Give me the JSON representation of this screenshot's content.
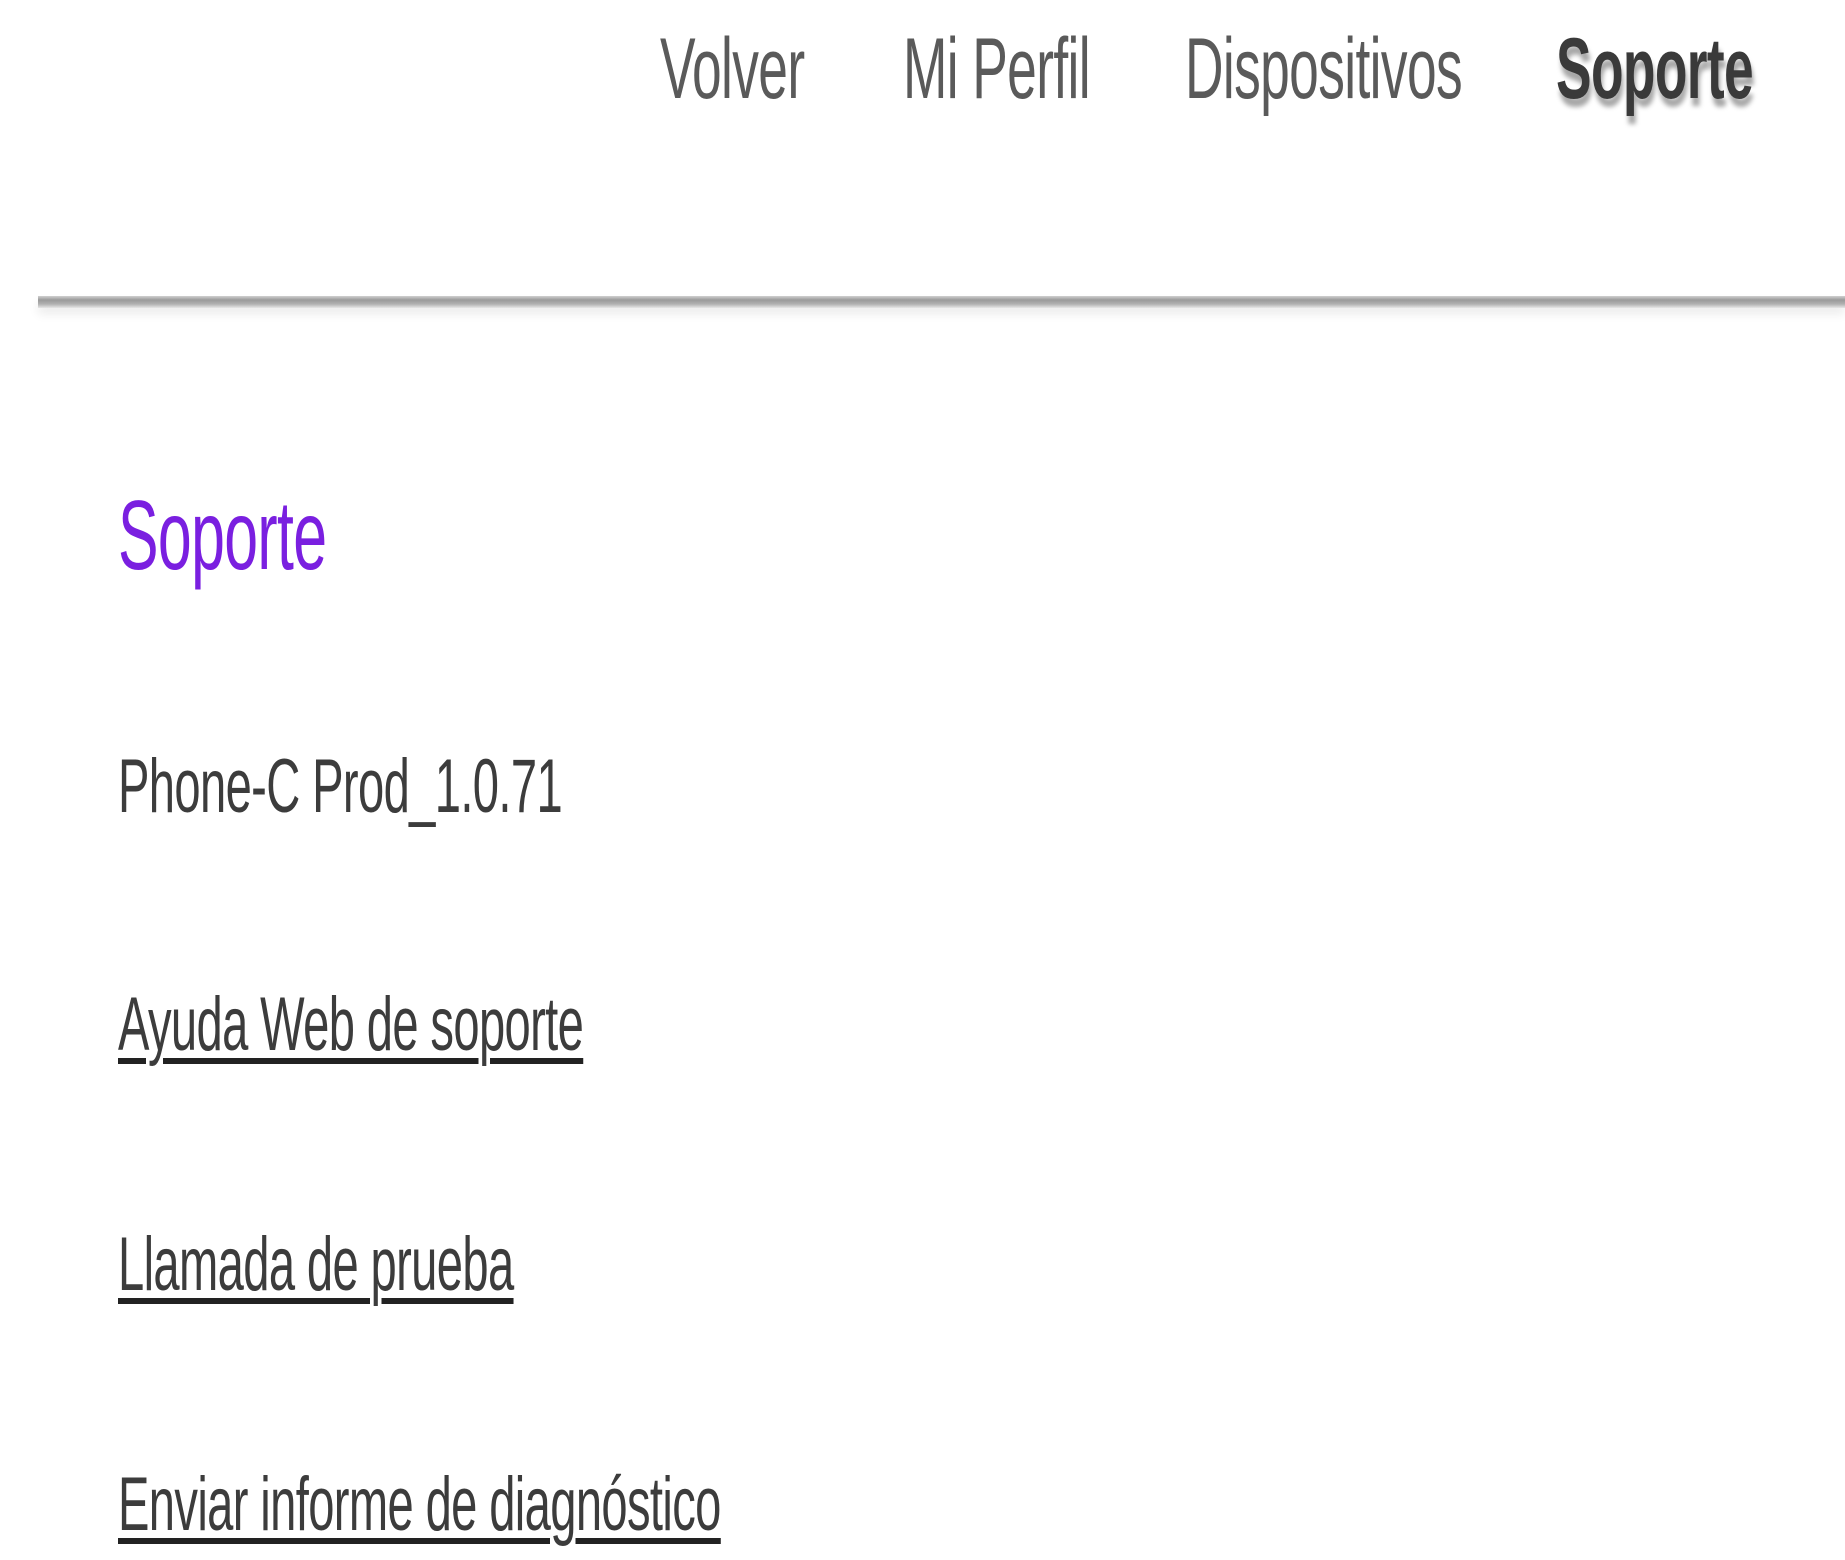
{
  "nav": {
    "items": [
      {
        "label": "Volver",
        "active": false
      },
      {
        "label": "Mi Perfil",
        "active": false
      },
      {
        "label": "Dispositivos",
        "active": false
      },
      {
        "label": "Soporte",
        "active": true
      }
    ]
  },
  "support": {
    "title": "Soporte",
    "version": "Phone-C Prod_1.0.71",
    "links": [
      {
        "label": "Ayuda Web de soporte"
      },
      {
        "label": "Llamada de prueba"
      },
      {
        "label": "Enviar informe de diagnóstico"
      }
    ]
  },
  "colors": {
    "title": "#7a1fe0",
    "text": "#3c3c3c",
    "nav_text": "#5a5a5a",
    "divider": "#9a9a9a"
  }
}
